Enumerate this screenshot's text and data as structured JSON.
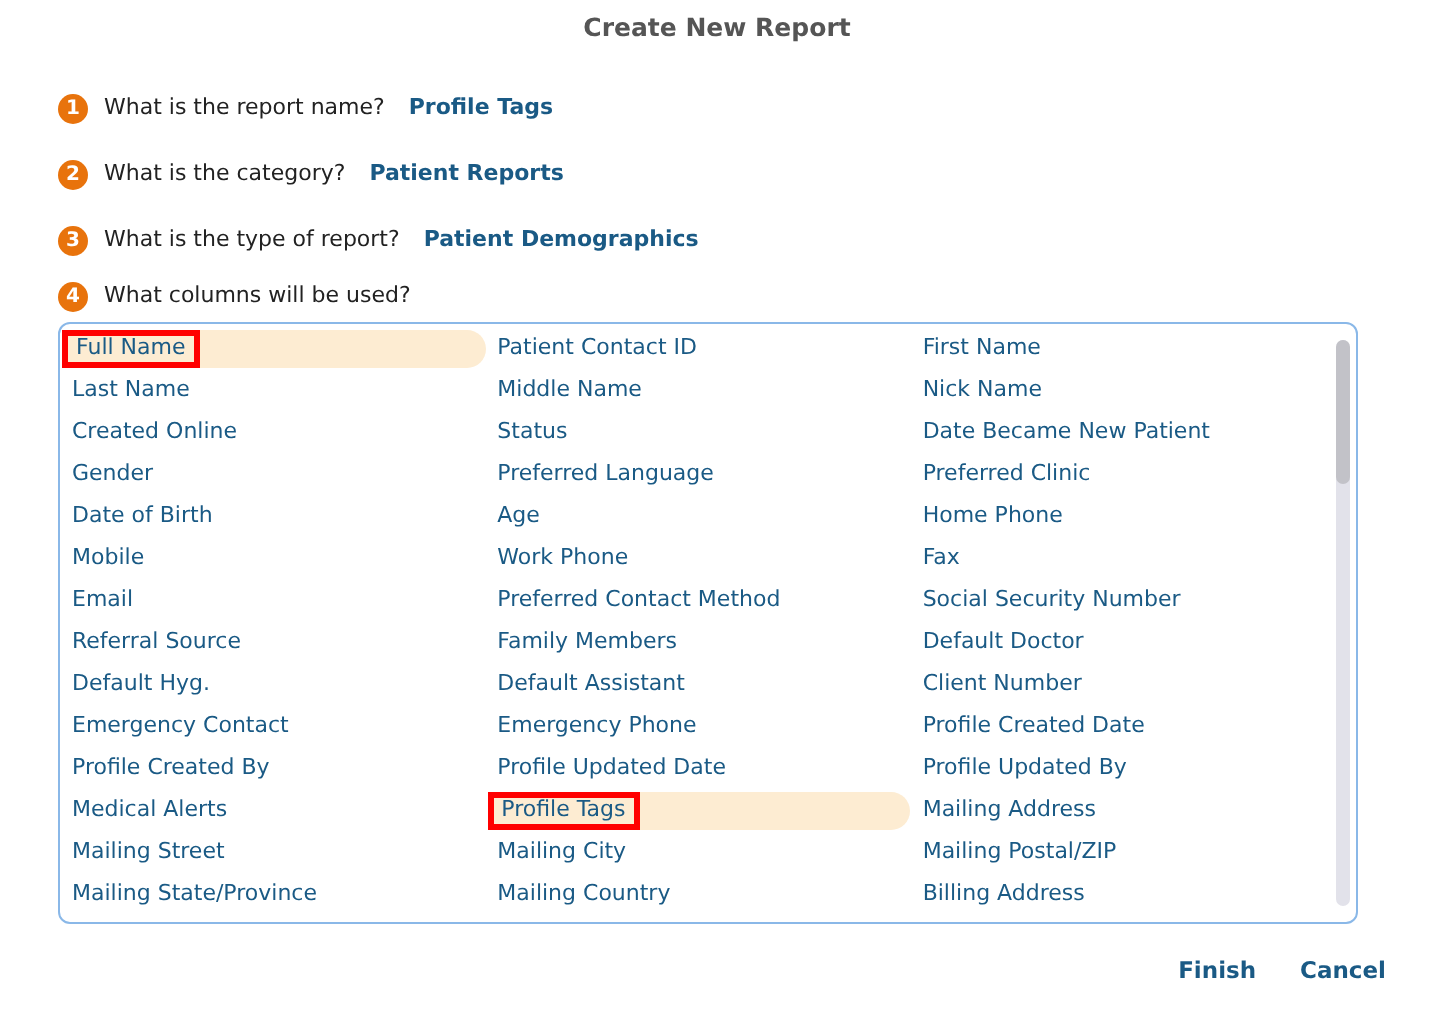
{
  "title": "Create New Report",
  "steps": [
    {
      "number": "1",
      "question": "What is the report name?",
      "answer": "Profile Tags"
    },
    {
      "number": "2",
      "question": "What is the category?",
      "answer": "Patient Reports"
    },
    {
      "number": "3",
      "question": "What is the type of report?",
      "answer": "Patient Demographics"
    },
    {
      "number": "4",
      "question": "What columns will be used?"
    }
  ],
  "columns": [
    {
      "label": "Full Name",
      "highlighted": true,
      "outlined": true
    },
    {
      "label": "Patient Contact ID",
      "highlighted": false,
      "outlined": false
    },
    {
      "label": "First Name",
      "highlighted": false,
      "outlined": false
    },
    {
      "label": "Last Name",
      "highlighted": false,
      "outlined": false
    },
    {
      "label": "Middle Name",
      "highlighted": false,
      "outlined": false
    },
    {
      "label": "Nick Name",
      "highlighted": false,
      "outlined": false
    },
    {
      "label": "Created Online",
      "highlighted": false,
      "outlined": false
    },
    {
      "label": "Status",
      "highlighted": false,
      "outlined": false
    },
    {
      "label": "Date Became New Patient",
      "highlighted": false,
      "outlined": false
    },
    {
      "label": "Gender",
      "highlighted": false,
      "outlined": false
    },
    {
      "label": "Preferred Language",
      "highlighted": false,
      "outlined": false
    },
    {
      "label": "Preferred Clinic",
      "highlighted": false,
      "outlined": false
    },
    {
      "label": "Date of Birth",
      "highlighted": false,
      "outlined": false
    },
    {
      "label": "Age",
      "highlighted": false,
      "outlined": false
    },
    {
      "label": "Home Phone",
      "highlighted": false,
      "outlined": false
    },
    {
      "label": "Mobile",
      "highlighted": false,
      "outlined": false
    },
    {
      "label": "Work Phone",
      "highlighted": false,
      "outlined": false
    },
    {
      "label": "Fax",
      "highlighted": false,
      "outlined": false
    },
    {
      "label": "Email",
      "highlighted": false,
      "outlined": false
    },
    {
      "label": "Preferred Contact Method",
      "highlighted": false,
      "outlined": false
    },
    {
      "label": "Social Security Number",
      "highlighted": false,
      "outlined": false
    },
    {
      "label": "Referral Source",
      "highlighted": false,
      "outlined": false
    },
    {
      "label": "Family Members",
      "highlighted": false,
      "outlined": false
    },
    {
      "label": "Default Doctor",
      "highlighted": false,
      "outlined": false
    },
    {
      "label": "Default Hyg.",
      "highlighted": false,
      "outlined": false
    },
    {
      "label": "Default Assistant",
      "highlighted": false,
      "outlined": false
    },
    {
      "label": "Client Number",
      "highlighted": false,
      "outlined": false
    },
    {
      "label": "Emergency Contact",
      "highlighted": false,
      "outlined": false
    },
    {
      "label": "Emergency Phone",
      "highlighted": false,
      "outlined": false
    },
    {
      "label": "Profile Created Date",
      "highlighted": false,
      "outlined": false
    },
    {
      "label": "Profile Created By",
      "highlighted": false,
      "outlined": false
    },
    {
      "label": "Profile Updated Date",
      "highlighted": false,
      "outlined": false
    },
    {
      "label": "Profile Updated By",
      "highlighted": false,
      "outlined": false
    },
    {
      "label": "Medical Alerts",
      "highlighted": false,
      "outlined": false
    },
    {
      "label": "Profile Tags",
      "highlighted": true,
      "outlined": true
    },
    {
      "label": "Mailing Address",
      "highlighted": false,
      "outlined": false
    },
    {
      "label": "Mailing Street",
      "highlighted": false,
      "outlined": false
    },
    {
      "label": "Mailing City",
      "highlighted": false,
      "outlined": false
    },
    {
      "label": "Mailing Postal/ZIP",
      "highlighted": false,
      "outlined": false
    },
    {
      "label": "Mailing State/Province",
      "highlighted": false,
      "outlined": false
    },
    {
      "label": "Mailing Country",
      "highlighted": false,
      "outlined": false
    },
    {
      "label": "Billing Address",
      "highlighted": false,
      "outlined": false
    }
  ],
  "buttons": [
    "Finish",
    "Cancel"
  ]
}
